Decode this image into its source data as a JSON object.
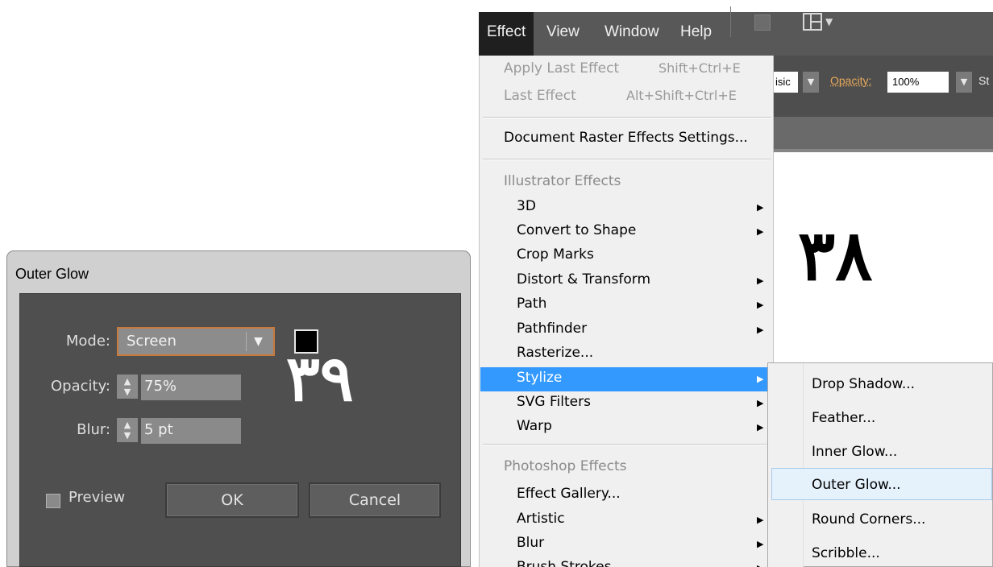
{
  "dialog": {
    "title": "Outer Glow",
    "mode_label": "Mode:",
    "mode_value": "Screen",
    "opacity_label": "Opacity:",
    "opacity_value": "75%",
    "blur_label": "Blur:",
    "blur_value": "5 pt",
    "preview_label": "Preview",
    "ok_label": "OK",
    "cancel_label": "Cancel",
    "overlay_number": "۳۹"
  },
  "menubar": {
    "items": [
      "Effect",
      "View",
      "Window",
      "Help"
    ]
  },
  "control_bar": {
    "style_fragment": "isic",
    "opacity_label": "Opacity:",
    "opacity_value": "100%",
    "tail_text": "St"
  },
  "canvas": {
    "overlay_number": "۳۸"
  },
  "effect_menu": {
    "apply_last": "Apply Last Effect",
    "apply_last_shortcut": "Shift+Ctrl+E",
    "last_effect": "Last Effect",
    "last_effect_shortcut": "Alt+Shift+Ctrl+E",
    "doc_raster": "Document Raster Effects Settings...",
    "illustrator_header": "Illustrator Effects",
    "illustrator_items": [
      "3D",
      "Convert to Shape",
      "Crop Marks",
      "Distort & Transform",
      "Path",
      "Pathfinder",
      "Rasterize...",
      "Stylize",
      "SVG Filters",
      "Warp"
    ],
    "photoshop_header": "Photoshop Effects",
    "photoshop_items": [
      "Effect Gallery...",
      "Artistic",
      "Blur",
      "Brush Strokes"
    ]
  },
  "stylize_submenu": {
    "items": [
      "Drop Shadow...",
      "Feather...",
      "Inner Glow...",
      "Outer Glow...",
      "Round Corners...",
      "Scribble..."
    ]
  },
  "colors": {
    "highlight": "#3399ff",
    "dialog_body": "#4f4f4f",
    "focus_border": "#c87a3a"
  }
}
